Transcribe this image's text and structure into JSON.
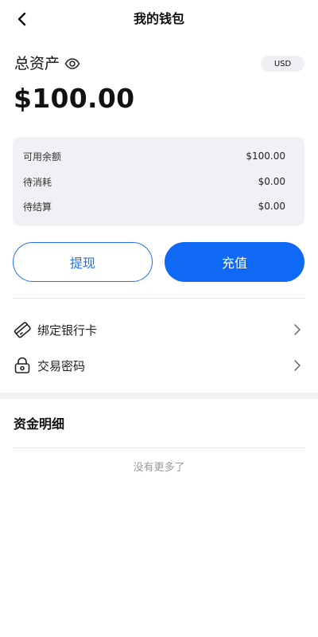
{
  "header": {
    "title": "我的钱包"
  },
  "summary": {
    "label": "总资产",
    "currency": "USD",
    "total": "$100.00"
  },
  "balances": [
    {
      "label": "可用余额",
      "value": "$100.00"
    },
    {
      "label": "待消耗",
      "value": "$0.00"
    },
    {
      "label": "待结算",
      "value": "$0.00"
    }
  ],
  "actions": {
    "withdraw": "提现",
    "recharge": "充值"
  },
  "menu": [
    {
      "label": "绑定银行卡",
      "icon": "bank-card-icon"
    },
    {
      "label": "交易密码",
      "icon": "lock-icon"
    }
  ],
  "details": {
    "title": "资金明细",
    "empty_text": "没有更多了"
  },
  "colors": {
    "accent": "#1069f5",
    "card_bg": "#f0f1f5",
    "muted_text": "#999999"
  }
}
